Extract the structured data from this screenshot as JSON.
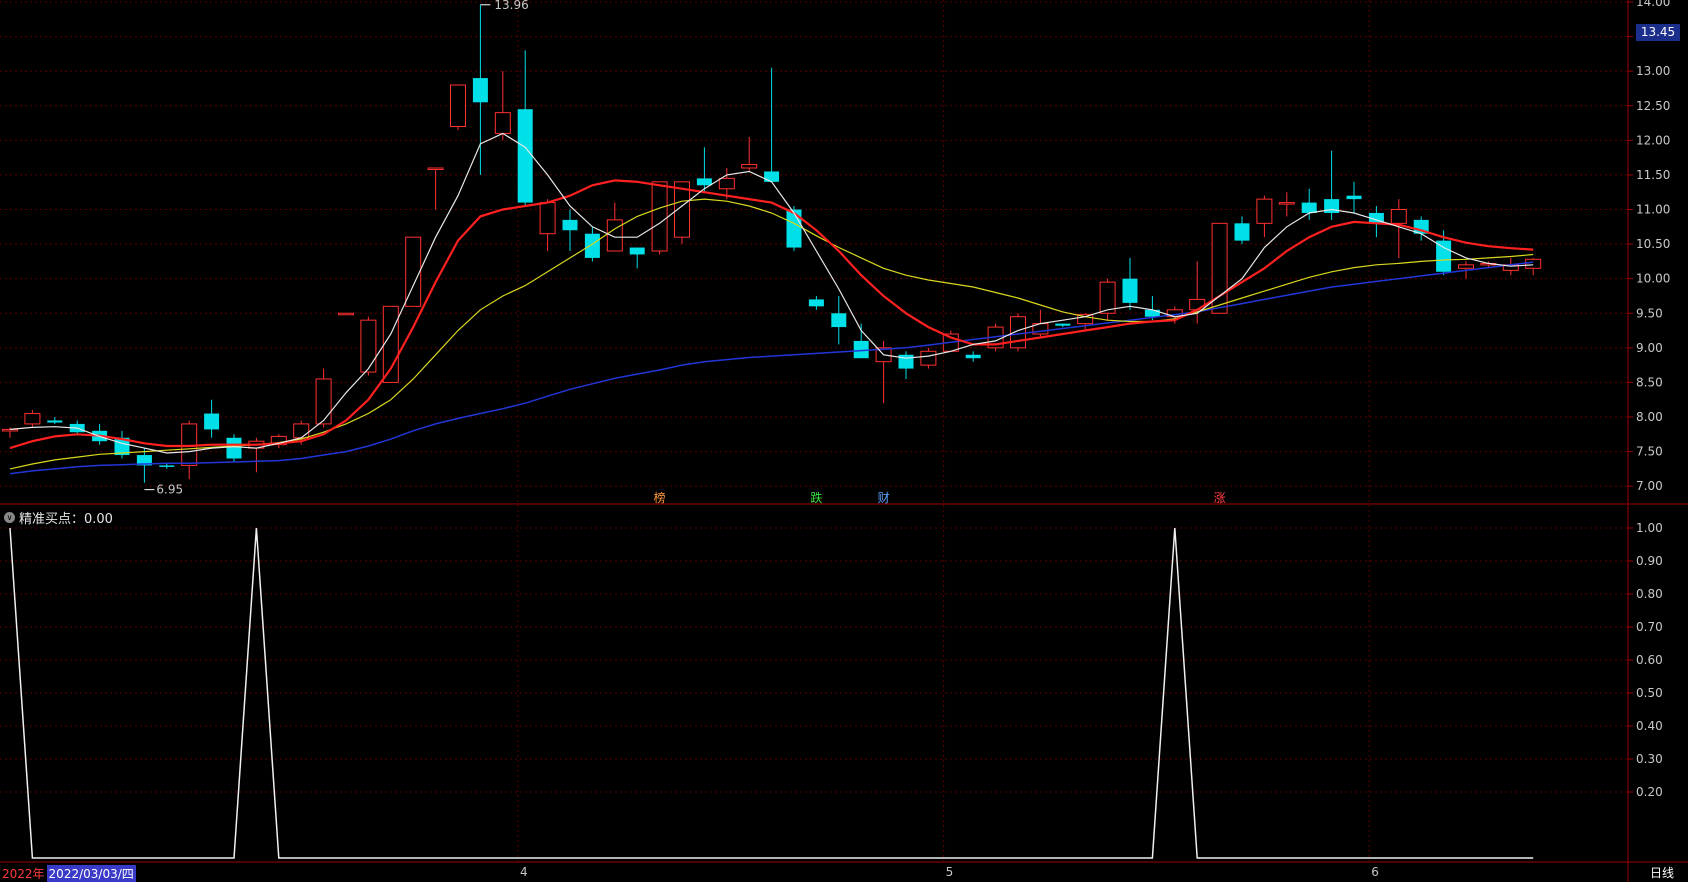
{
  "indicator": {
    "label": "精准买点：0.00"
  },
  "footer": {
    "year_label": "2022年",
    "cursor_date": "2022/03/03/四",
    "period": "日线"
  },
  "price_tag": "13.45",
  "markers": [
    {
      "label": "榜",
      "index": 29,
      "color": "#ff9a3c"
    },
    {
      "label": "跌",
      "index": 36,
      "color": "#39e639"
    },
    {
      "label": "财",
      "index": 39,
      "color": "#5aa0ff"
    },
    {
      "label": "涨",
      "index": 54,
      "color": "#ff4040"
    }
  ],
  "annotations": {
    "high": "13.96",
    "low": "6.95"
  },
  "month_labels": [
    {
      "label": "4",
      "index": 23
    },
    {
      "label": "5",
      "index": 42
    },
    {
      "label": "6",
      "index": 61
    }
  ],
  "chart_data": [
    {
      "type": "candlestick",
      "ylim": [
        6.8,
        14.0
      ],
      "y_ticks": [
        "7.00",
        "7.50",
        "8.00",
        "8.50",
        "9.00",
        "9.50",
        "10.00",
        "10.50",
        "11.00",
        "11.50",
        "12.00",
        "12.50",
        "13.00",
        "13.50",
        "14.00"
      ],
      "candles": [
        [
          7.8,
          7.85,
          7.7,
          7.82
        ],
        [
          7.9,
          8.1,
          7.85,
          8.05
        ],
        [
          7.95,
          8.0,
          7.9,
          7.92
        ],
        [
          7.9,
          7.95,
          7.75,
          7.78
        ],
        [
          7.8,
          7.9,
          7.6,
          7.65
        ],
        [
          7.7,
          7.8,
          7.4,
          7.45
        ],
        [
          7.45,
          7.55,
          7.05,
          7.3
        ],
        [
          7.3,
          7.32,
          7.25,
          7.28
        ],
        [
          7.3,
          7.95,
          7.1,
          7.9
        ],
        [
          8.05,
          8.25,
          7.7,
          7.82
        ],
        [
          7.7,
          7.75,
          7.35,
          7.4
        ],
        [
          7.55,
          7.7,
          7.2,
          7.65
        ],
        [
          7.6,
          7.75,
          7.55,
          7.72
        ],
        [
          7.7,
          7.95,
          7.6,
          7.9
        ],
        [
          7.9,
          8.7,
          7.85,
          8.55
        ],
        [
          9.5,
          9.5,
          9.5,
          9.5
        ],
        [
          8.65,
          9.45,
          8.6,
          9.4
        ],
        [
          8.5,
          9.6,
          8.5,
          9.6
        ],
        [
          9.6,
          10.6,
          9.6,
          10.6
        ],
        [
          11.6,
          11.6,
          11.0,
          11.6
        ],
        [
          12.2,
          12.8,
          12.15,
          12.8
        ],
        [
          12.9,
          13.96,
          11.5,
          12.55
        ],
        [
          12.1,
          13.0,
          12.0,
          12.4
        ],
        [
          12.45,
          13.3,
          11.05,
          11.1
        ],
        [
          10.65,
          11.15,
          10.4,
          11.1
        ],
        [
          10.85,
          11.0,
          10.4,
          10.7
        ],
        [
          10.65,
          10.75,
          10.25,
          10.3
        ],
        [
          10.4,
          11.1,
          10.4,
          10.85
        ],
        [
          10.45,
          10.4,
          10.15,
          10.35
        ],
        [
          10.4,
          11.4,
          10.35,
          11.4
        ],
        [
          10.6,
          11.4,
          10.5,
          11.4
        ],
        [
          11.45,
          11.9,
          11.25,
          11.35
        ],
        [
          11.3,
          11.6,
          11.15,
          11.45
        ],
        [
          11.6,
          12.05,
          11.55,
          11.65
        ],
        [
          11.55,
          13.05,
          11.4,
          11.4
        ],
        [
          11.0,
          11.05,
          10.4,
          10.45
        ],
        [
          9.7,
          9.75,
          9.55,
          9.6
        ],
        [
          9.5,
          9.75,
          9.05,
          9.3
        ],
        [
          9.1,
          9.35,
          8.85,
          8.85
        ],
        [
          8.8,
          9.1,
          8.2,
          9.0
        ],
        [
          8.9,
          8.95,
          8.55,
          8.7
        ],
        [
          8.75,
          9.0,
          8.7,
          8.95
        ],
        [
          8.95,
          9.25,
          8.95,
          9.2
        ],
        [
          8.9,
          8.95,
          8.8,
          8.85
        ],
        [
          9.0,
          9.35,
          8.95,
          9.3
        ],
        [
          9.0,
          9.5,
          8.95,
          9.45
        ],
        [
          9.2,
          9.55,
          9.15,
          9.35
        ],
        [
          9.35,
          9.35,
          9.3,
          9.32
        ],
        [
          9.35,
          9.5,
          9.25,
          9.48
        ],
        [
          9.5,
          10.0,
          9.4,
          9.95
        ],
        [
          10.0,
          10.3,
          9.55,
          9.65
        ],
        [
          9.55,
          9.75,
          9.4,
          9.45
        ],
        [
          9.45,
          9.6,
          9.35,
          9.55
        ],
        [
          9.55,
          10.25,
          9.35,
          9.7
        ],
        [
          9.5,
          10.8,
          9.5,
          10.8
        ],
        [
          10.8,
          10.9,
          10.5,
          10.55
        ],
        [
          10.8,
          11.2,
          10.6,
          11.15
        ],
        [
          11.1,
          11.25,
          10.9,
          11.1
        ],
        [
          11.1,
          11.3,
          10.85,
          10.95
        ],
        [
          11.15,
          11.85,
          10.85,
          10.95
        ],
        [
          11.2,
          11.4,
          10.95,
          11.15
        ],
        [
          10.95,
          11.05,
          10.6,
          10.8
        ],
        [
          10.8,
          11.15,
          10.3,
          11.0
        ],
        [
          10.85,
          10.9,
          10.55,
          10.65
        ],
        [
          10.55,
          10.7,
          10.05,
          10.1
        ],
        [
          10.15,
          10.25,
          10.0,
          10.2
        ],
        [
          10.2,
          10.25,
          10.15,
          10.22
        ],
        [
          10.12,
          10.3,
          10.05,
          10.2
        ],
        [
          10.15,
          10.3,
          10.05,
          10.28
        ]
      ],
      "ma_white": [
        7.82,
        7.85,
        7.86,
        7.84,
        7.72,
        7.62,
        7.55,
        7.48,
        7.5,
        7.55,
        7.57,
        7.55,
        7.62,
        7.7,
        7.95,
        8.35,
        8.7,
        9.2,
        9.9,
        10.6,
        11.2,
        11.95,
        12.1,
        11.9,
        11.5,
        11.05,
        10.75,
        10.6,
        10.6,
        10.8,
        11.05,
        11.3,
        11.5,
        11.55,
        11.4,
        10.95,
        10.4,
        9.85,
        9.25,
        8.9,
        8.85,
        8.88,
        8.95,
        9.05,
        9.1,
        9.25,
        9.35,
        9.4,
        9.45,
        9.55,
        9.6,
        9.55,
        9.45,
        9.5,
        9.75,
        10.0,
        10.45,
        10.75,
        10.95,
        11.0,
        10.95,
        10.85,
        10.75,
        10.65,
        10.45,
        10.3,
        10.22,
        10.18,
        10.2
      ],
      "ma_red": [
        7.55,
        7.65,
        7.72,
        7.75,
        7.73,
        7.68,
        7.62,
        7.58,
        7.58,
        7.6,
        7.6,
        7.6,
        7.62,
        7.65,
        7.75,
        7.95,
        8.25,
        8.7,
        9.3,
        9.95,
        10.55,
        10.9,
        11.0,
        11.05,
        11.1,
        11.2,
        11.35,
        11.42,
        11.4,
        11.35,
        11.3,
        11.25,
        11.2,
        11.15,
        11.1,
        10.95,
        10.7,
        10.4,
        10.05,
        9.75,
        9.5,
        9.3,
        9.15,
        9.05,
        9.05,
        9.1,
        9.15,
        9.2,
        9.25,
        9.3,
        9.35,
        9.38,
        9.4,
        9.55,
        9.75,
        9.95,
        10.15,
        10.4,
        10.6,
        10.75,
        10.82,
        10.8,
        10.78,
        10.7,
        10.6,
        10.52,
        10.47,
        10.44,
        10.42
      ],
      "ma_yellow": [
        7.25,
        7.32,
        7.38,
        7.42,
        7.46,
        7.48,
        7.5,
        7.52,
        7.54,
        7.56,
        7.58,
        7.6,
        7.63,
        7.68,
        7.78,
        7.9,
        8.05,
        8.25,
        8.55,
        8.9,
        9.25,
        9.55,
        9.75,
        9.9,
        10.1,
        10.3,
        10.5,
        10.72,
        10.9,
        11.02,
        11.12,
        11.15,
        11.12,
        11.05,
        10.95,
        10.8,
        10.62,
        10.45,
        10.3,
        10.15,
        10.05,
        9.98,
        9.93,
        9.88,
        9.8,
        9.72,
        9.62,
        9.52,
        9.45,
        9.4,
        9.38,
        9.38,
        9.42,
        9.52,
        9.62,
        9.72,
        9.82,
        9.92,
        10.02,
        10.1,
        10.16,
        10.2,
        10.22,
        10.25,
        10.27,
        10.28,
        10.3,
        10.32,
        10.35
      ],
      "ma_blue": [
        7.18,
        7.22,
        7.25,
        7.28,
        7.3,
        7.31,
        7.32,
        7.33,
        7.33,
        7.34,
        7.35,
        7.36,
        7.37,
        7.4,
        7.45,
        7.5,
        7.58,
        7.68,
        7.8,
        7.9,
        7.98,
        8.05,
        8.12,
        8.2,
        8.3,
        8.4,
        8.48,
        8.56,
        8.62,
        8.68,
        8.75,
        8.8,
        8.83,
        8.86,
        8.88,
        8.9,
        8.92,
        8.94,
        8.96,
        8.98,
        9.0,
        9.04,
        9.08,
        9.12,
        9.16,
        9.2,
        9.24,
        9.28,
        9.32,
        9.36,
        9.4,
        9.44,
        9.48,
        9.52,
        9.58,
        9.64,
        9.7,
        9.76,
        9.82,
        9.88,
        9.92,
        9.96,
        10.0,
        10.04,
        10.08,
        10.12,
        10.16,
        10.2,
        10.24
      ]
    },
    {
      "type": "line",
      "ylim": [
        0,
        1.05
      ],
      "y_ticks": [
        "0.20",
        "0.30",
        "0.40",
        "0.50",
        "0.60",
        "0.70",
        "0.80",
        "0.90",
        "1.00"
      ],
      "values": [
        1,
        0,
        0,
        0,
        0,
        0,
        0,
        0,
        0,
        0,
        0,
        1,
        0,
        0,
        0,
        0,
        0,
        0,
        0,
        0,
        0,
        0,
        0,
        0,
        0,
        0,
        0,
        0,
        0,
        0,
        0,
        0,
        0,
        0,
        0,
        0,
        0,
        0,
        0,
        0,
        0,
        0,
        0,
        0,
        0,
        0,
        0,
        0,
        0,
        0,
        0,
        0,
        1,
        0,
        0,
        0,
        0,
        0,
        0,
        0,
        0,
        0,
        0,
        0,
        0,
        0,
        0,
        0,
        0
      ]
    }
  ]
}
